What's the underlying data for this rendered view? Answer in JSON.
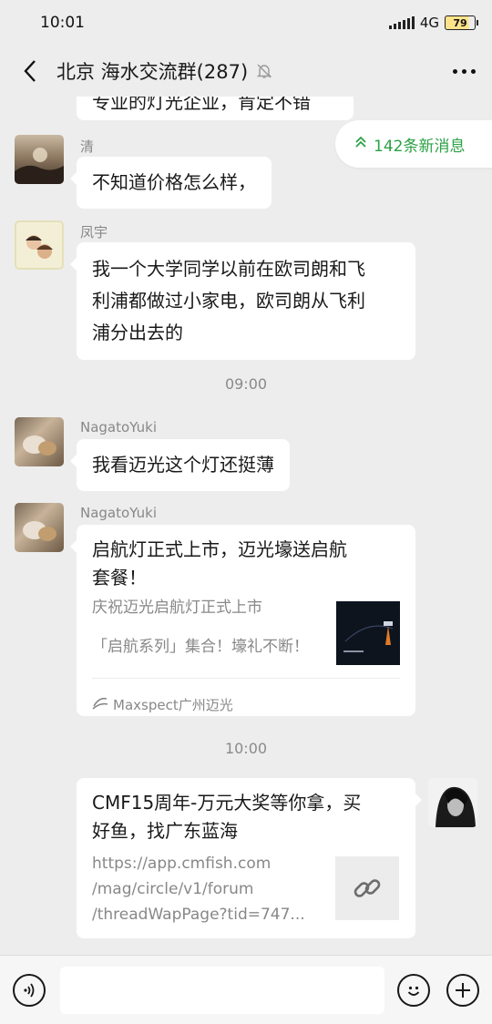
{
  "status": {
    "time": "10:01",
    "network": "4G",
    "battery": "79"
  },
  "header": {
    "title": "北京 海水交流群(287)"
  },
  "new_messages": {
    "label": "142条新消息"
  },
  "messages": [
    {
      "partial_text": "专业的灯光企业，肯定不错"
    },
    {
      "sender": "清",
      "text": "不知道价格怎么样，"
    },
    {
      "sender": "凤宇",
      "text_lines": [
        "我一个大学同学以前在欧司朗和飞",
        "利浦都做过小家电，欧司朗从飞利",
        "浦分出去的"
      ]
    },
    {
      "time": "09:00"
    },
    {
      "sender": "NagatoYuki",
      "text": "我看迈光这个灯还挺薄"
    },
    {
      "sender": "NagatoYuki",
      "card": {
        "title_lines": [
          "启航灯正式上市，迈光壕送启航",
          "套餐！"
        ],
        "desc_lines": [
          "庆祝迈光启航灯正式上市",
          "「启航系列」集合！壕礼不断！"
        ],
        "source": "Maxspect广州迈光"
      }
    },
    {
      "time": "10:00"
    },
    {
      "self": true,
      "card": {
        "title_lines": [
          "CMF15周年-万元大奖等你拿，买",
          "好鱼，找广东蓝海"
        ],
        "url_lines": [
          "https://app.cmfish.com",
          "/mag/circle/v1/forum",
          "/threadWapPage?tid=747..."
        ]
      }
    }
  ],
  "colors": {
    "accent": "#2ba245",
    "background": "#ededed"
  }
}
